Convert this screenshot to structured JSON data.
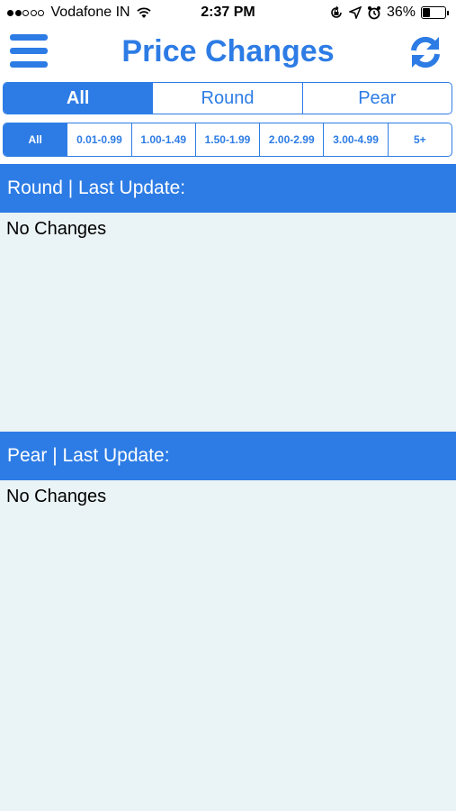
{
  "status_bar": {
    "carrier": "Vodafone IN",
    "time": "2:37 PM",
    "battery": "36%",
    "battery_level": 0.36,
    "signal_filled": 2,
    "signal_total": 5
  },
  "header": {
    "title": "Price Changes",
    "menu_icon": "hamburger-menu-icon",
    "refresh_icon": "refresh-icon"
  },
  "shape_tabs": [
    {
      "label": "All",
      "active": true
    },
    {
      "label": "Round",
      "active": false
    },
    {
      "label": "Pear",
      "active": false
    }
  ],
  "price_tabs": [
    {
      "label": "All",
      "active": true
    },
    {
      "label": "0.01-0.99",
      "active": false
    },
    {
      "label": "1.00-1.49",
      "active": false
    },
    {
      "label": "1.50-1.99",
      "active": false
    },
    {
      "label": "2.00-2.99",
      "active": false
    },
    {
      "label": "3.00-4.99",
      "active": false
    },
    {
      "label": "5+",
      "active": false
    }
  ],
  "sections": [
    {
      "header": "Round | Last Update:",
      "message": "No Changes"
    },
    {
      "header": "Pear | Last Update:",
      "message": "No Changes"
    }
  ],
  "colors": {
    "accent": "#2d7ce5",
    "content_bg": "#eaf3f5"
  }
}
